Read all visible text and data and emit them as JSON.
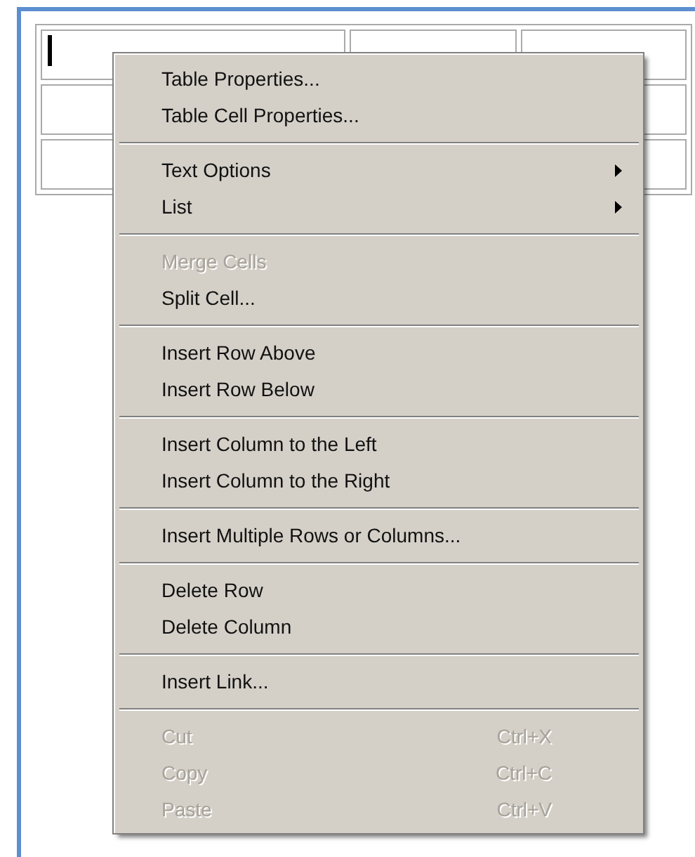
{
  "table": {
    "rows": [
      {
        "cells": [
          {
            "kind": "cell",
            "cursor": true
          },
          {
            "kind": "cell",
            "cursor": false
          },
          {
            "kind": "cell",
            "cursor": false
          }
        ]
      },
      {
        "cells": [
          {
            "kind": "cell",
            "cursor": false
          },
          {
            "kind": "covered"
          },
          {
            "kind": "cell",
            "cursor": false
          }
        ]
      },
      {
        "cells": [
          {
            "kind": "cell",
            "cursor": false
          },
          {
            "kind": "covered"
          },
          {
            "kind": "cell",
            "cursor": false
          }
        ]
      }
    ]
  },
  "context_menu": {
    "items": [
      {
        "kind": "item",
        "label": "Table Properties...",
        "disabled": false
      },
      {
        "kind": "item",
        "label": "Table Cell Properties...",
        "disabled": false
      },
      {
        "kind": "separator"
      },
      {
        "kind": "item",
        "label": "Text Options",
        "disabled": false,
        "submenu": true
      },
      {
        "kind": "item",
        "label": "List",
        "disabled": false,
        "submenu": true
      },
      {
        "kind": "separator"
      },
      {
        "kind": "item",
        "label": "Merge Cells",
        "disabled": true
      },
      {
        "kind": "item",
        "label": "Split Cell...",
        "disabled": false
      },
      {
        "kind": "separator"
      },
      {
        "kind": "item",
        "label": "Insert Row Above",
        "disabled": false
      },
      {
        "kind": "item",
        "label": "Insert Row Below",
        "disabled": false
      },
      {
        "kind": "separator"
      },
      {
        "kind": "item",
        "label": "Insert Column to the Left",
        "disabled": false
      },
      {
        "kind": "item",
        "label": "Insert Column to the Right",
        "disabled": false
      },
      {
        "kind": "separator"
      },
      {
        "kind": "item",
        "label": "Insert Multiple Rows or Columns...",
        "disabled": false
      },
      {
        "kind": "separator"
      },
      {
        "kind": "item",
        "label": "Delete Row",
        "disabled": false
      },
      {
        "kind": "item",
        "label": "Delete Column",
        "disabled": false
      },
      {
        "kind": "separator"
      },
      {
        "kind": "item",
        "label": "Insert Link...",
        "disabled": false
      },
      {
        "kind": "separator"
      },
      {
        "kind": "item",
        "label": "Cut",
        "disabled": true,
        "shortcut": "Ctrl+X"
      },
      {
        "kind": "item",
        "label": "Copy",
        "disabled": true,
        "shortcut": "Ctrl+C"
      },
      {
        "kind": "item",
        "label": "Paste",
        "disabled": true,
        "shortcut": "Ctrl+V"
      }
    ]
  }
}
